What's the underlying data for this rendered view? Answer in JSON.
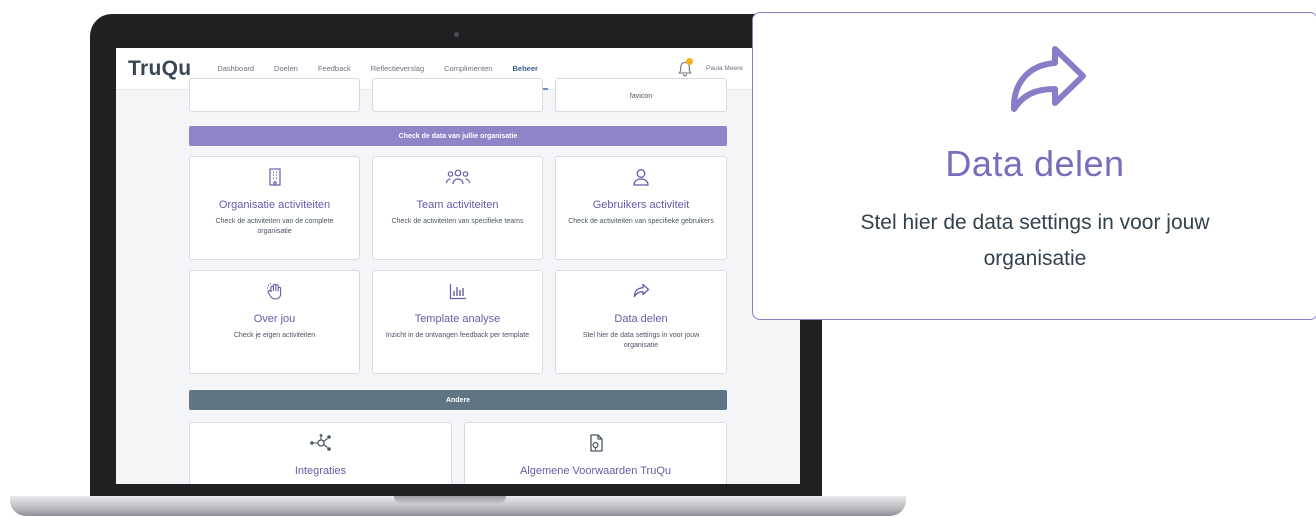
{
  "app": {
    "logo": "TruQu",
    "nav": [
      "Dashboard",
      "Doelen",
      "Feedback",
      "Reflectieverslag",
      "Complimenten",
      "Beheer"
    ],
    "active_nav": "Beheer",
    "user_name": "Paula Meere"
  },
  "top_partial": {
    "favicon_label": "favicon"
  },
  "sections": {
    "check_data": "Check de data van jullie organisatie",
    "other": "Andere"
  },
  "cards": [
    {
      "icon": "building-icon",
      "title": "Organisatie activiteiten",
      "desc": "Check de activiteiten van de complete organisatie"
    },
    {
      "icon": "team-icon",
      "title": "Team activiteiten",
      "desc": "Check de activiteiten van specifieke teams"
    },
    {
      "icon": "user-icon",
      "title": "Gebruikers activiteit",
      "desc": "Check de activiteiten van specifieke gebruikers"
    },
    {
      "icon": "hand-icon",
      "title": "Over jou",
      "desc": "Check je eigen activiteiten"
    },
    {
      "icon": "bar-chart-icon",
      "title": "Template analyse",
      "desc": "Inzicht in de ontvangen feedback per template"
    },
    {
      "icon": "share-icon",
      "title": "Data delen",
      "desc": "Stel hier de data settings in voor jouw organisatie"
    }
  ],
  "other_cards": [
    {
      "icon": "integration-icon",
      "title": "Integraties"
    },
    {
      "icon": "document-icon",
      "title": "Algemene Voorwaarden TruQu"
    }
  ],
  "callout": {
    "icon": "share-arrow-icon",
    "title": "Data delen",
    "text": "Stel hier de data settings in voor jouw organisatie"
  },
  "colors": {
    "accent_purple": "#8e84c8",
    "title_purple": "#7a6cbc",
    "slate": "#5f7583",
    "notification": "#f2b31a"
  }
}
